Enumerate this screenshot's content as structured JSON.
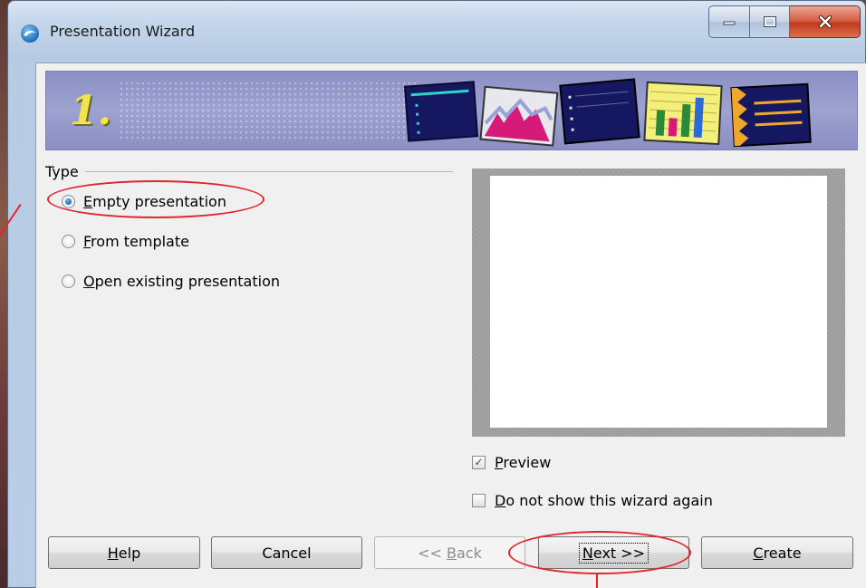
{
  "window": {
    "title": "Presentation Wizard"
  },
  "banner": {
    "step": "1."
  },
  "type_group": {
    "label": "Type",
    "options": [
      {
        "mnemonic": "E",
        "rest": "mpty presentation",
        "checked": true
      },
      {
        "mnemonic": "F",
        "rest": "rom template",
        "checked": false
      },
      {
        "mnemonic": "O",
        "rest": "pen existing presentation",
        "checked": false
      }
    ]
  },
  "preview_checkbox": {
    "mnemonic": "P",
    "rest": "review",
    "checked": true
  },
  "dont_show_checkbox": {
    "mnemonic": "D",
    "rest": "o not show this wizard again",
    "checked": false
  },
  "buttons": {
    "help": {
      "mnemonic": "H",
      "rest": "elp"
    },
    "cancel": {
      "label": "Cancel"
    },
    "back": {
      "prefix": "<< ",
      "mnemonic": "B",
      "rest": "ack"
    },
    "next": {
      "mnemonic": "N",
      "rest": "ext >>"
    },
    "create": {
      "mnemonic": "C",
      "rest": "reate"
    }
  },
  "colors": {
    "annotation": "#e0262c",
    "banner": "#9ea2d0",
    "step_number": "#f3e44a"
  }
}
